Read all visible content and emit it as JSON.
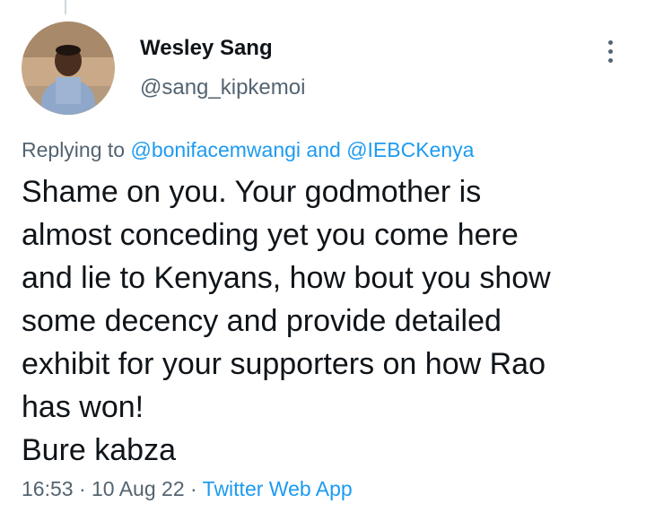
{
  "tweet": {
    "author": {
      "name": "Wesley Sang",
      "handle": "@sang_kipkemoi"
    },
    "reply": {
      "prefix": "Replying to",
      "mention1": "@bonifacemwangi",
      "conjunction": "and",
      "mention2": "@IEBCKenya"
    },
    "body_lines": [
      "Shame on you. Your godmother is",
      "almost conceding yet you come here",
      "and lie to Kenyans, how bout you show",
      "some decency and provide detailed",
      "exhibit for your supporters on how Rao",
      "has won!",
      "Bure kabza"
    ],
    "meta": {
      "time": "16:53",
      "separator1": "·",
      "date": "10 Aug 22",
      "separator2": "·",
      "source": "Twitter Web App"
    }
  },
  "colors": {
    "text_primary": "#0f1419",
    "text_secondary": "#536471",
    "link": "#1d9bf0"
  },
  "icons": {
    "more": "more-options-icon"
  }
}
